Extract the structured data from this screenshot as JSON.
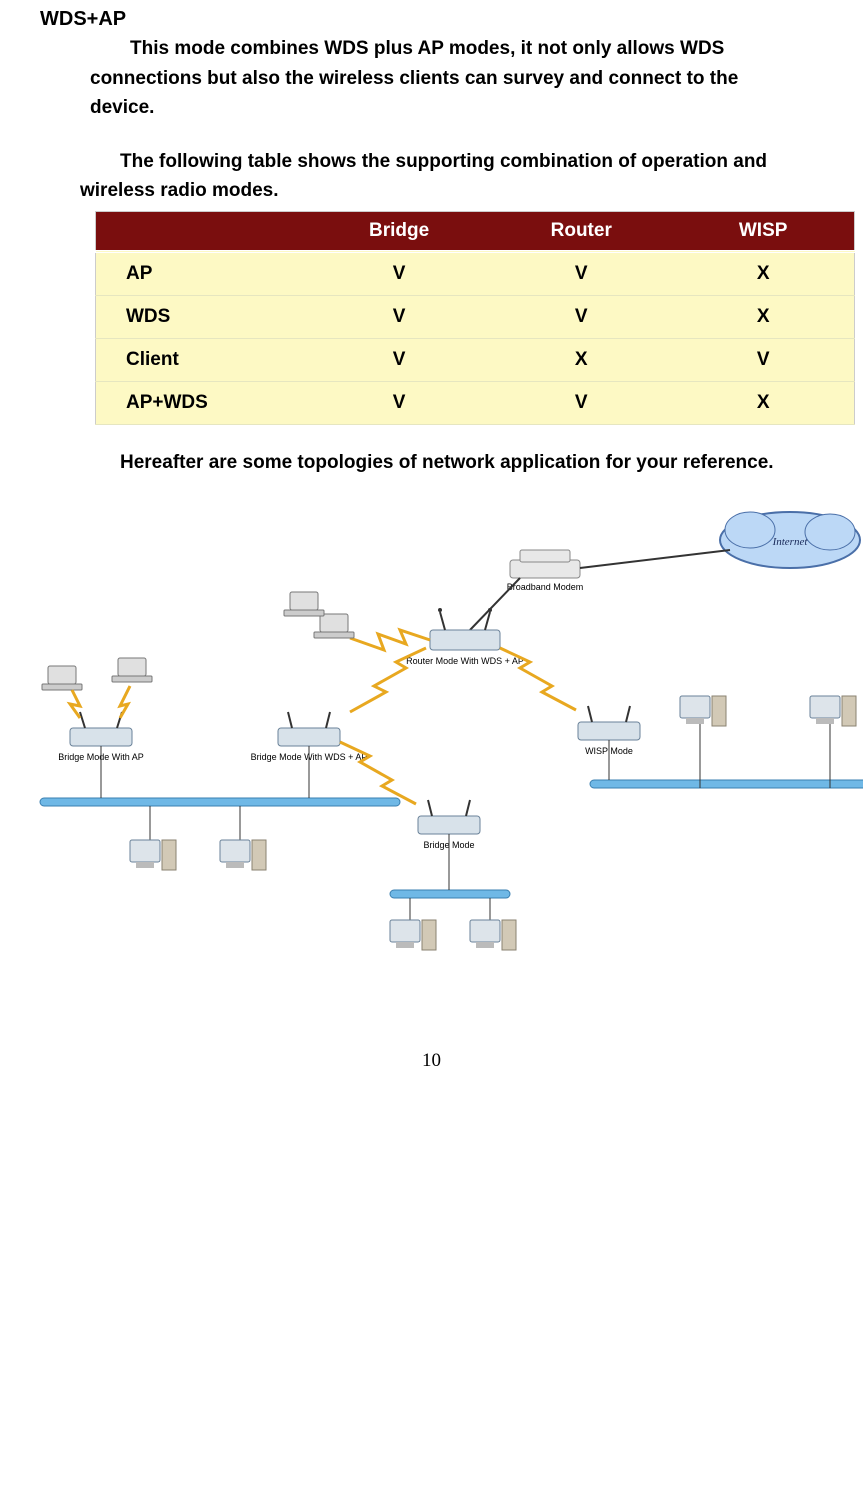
{
  "section_title": "WDS+AP",
  "para1_line1": "This mode combines WDS plus AP modes, it not only allows WDS",
  "para1_line2": "connections but also the wireless clients can survey and connect to the",
  "para1_line3": "device.",
  "para2_line1": "The following table shows the supporting combination of operation and",
  "para2_line2": "wireless radio modes.",
  "table": {
    "headers": [
      "",
      "Bridge",
      "Router",
      "WISP"
    ],
    "rows": [
      {
        "mode": "AP",
        "cells": [
          "V",
          "V",
          "X"
        ]
      },
      {
        "mode": "WDS",
        "cells": [
          "V",
          "V",
          "X"
        ]
      },
      {
        "mode": "Client",
        "cells": [
          "V",
          "X",
          "V"
        ]
      },
      {
        "mode": "AP+WDS",
        "cells": [
          "V",
          "V",
          "X"
        ]
      }
    ]
  },
  "para3": "Hereafter are some topologies of network application for your reference.",
  "diagram_labels": {
    "internet": "Internet",
    "broadband_modem": "Broadband Modem",
    "router_mode": "Router Mode With WDS + AP",
    "bridge_ap": "Bridge Mode With AP",
    "bridge_wds_ap": "Bridge Mode With WDS + AP",
    "wisp_mode": "WISP Mode",
    "bridge_mode": "Bridge Mode"
  },
  "page_number": "10"
}
